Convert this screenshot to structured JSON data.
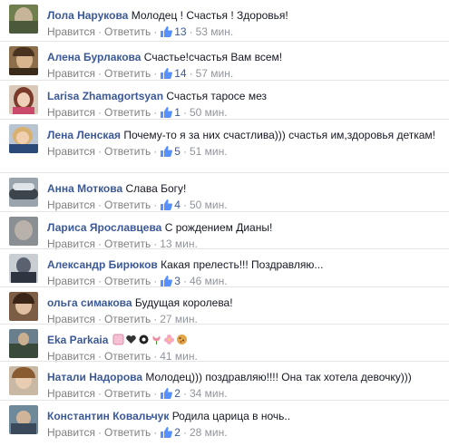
{
  "actions": {
    "like": "Нравится",
    "reply": "Ответить"
  },
  "comments": [
    {
      "name": "Лола Нарукова",
      "text": "Молодец ! Счастья ! Здоровья!",
      "likes": "13",
      "time": "53 мин."
    },
    {
      "name": "Алена Бурлакова",
      "text": "Счастье!счастья Вам всем!",
      "likes": "14",
      "time": "57 мин."
    },
    {
      "name": "Larisa Zhamagortsyan",
      "text": "Счастья таросе мез",
      "likes": "1",
      "time": "50 мин."
    },
    {
      "name": "Лена Ленская",
      "text": "Почему-то я за них счастлива))) счастья им,здоровья деткам!",
      "likes": "5",
      "time": "51 мин."
    },
    {
      "name": "Анна Моткова",
      "text": "Слава Богу!",
      "likes": "4",
      "time": "50 мин."
    },
    {
      "name": "Лариса Ярославцева",
      "text": "С рождением Дианы!",
      "likes": "",
      "time": "13 мин."
    },
    {
      "name": "Александр Бирюков",
      "text": "Какая прелесть!!! Поздравляю...",
      "likes": "3",
      "time": "46 мин."
    },
    {
      "name": "ольга симакова",
      "text": "Будущая королева!",
      "likes": "",
      "time": "27 мин."
    },
    {
      "name": "Eka Parkaia",
      "text": "",
      "likes": "",
      "time": "41 мин."
    },
    {
      "name": "Натали Надорова",
      "text": "Молодец))) поздравляю!!!! Она так хотела девочку)))",
      "likes": "2",
      "time": "34 мин."
    },
    {
      "name": "Константин Ковальчук",
      "text": "Родила царица в ночь..",
      "likes": "2",
      "time": "28 мин."
    }
  ],
  "colors": {
    "name": "#3b5998",
    "meta": "#90949c",
    "like": "#5890ff"
  }
}
